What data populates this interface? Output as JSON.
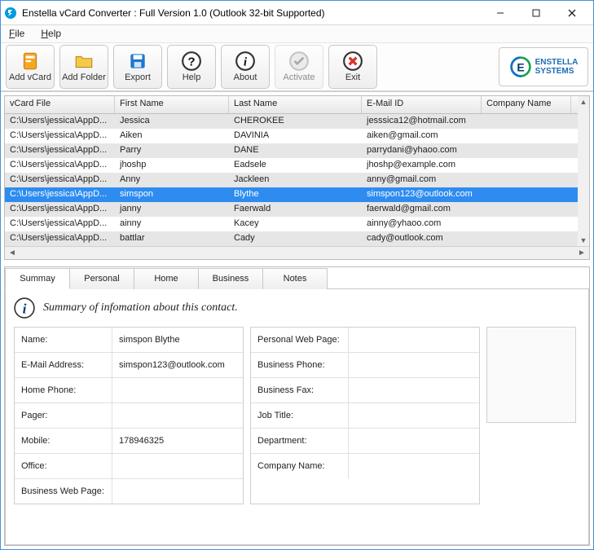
{
  "window": {
    "title": "Enstella vCard Converter : Full Version 1.0 (Outlook 32-bit Supported)"
  },
  "menu": {
    "file": "File",
    "help": "Help"
  },
  "toolbar": {
    "add_vcard": "Add vCard",
    "add_folder": "Add Folder",
    "export": "Export",
    "help": "Help",
    "about": "About",
    "activate": "Activate",
    "exit": "Exit"
  },
  "brand": {
    "line1": "ENSTELLA",
    "line2": "SYSTEMS"
  },
  "grid": {
    "headers": {
      "file": "vCard File",
      "first": "First Name",
      "last": "Last Name",
      "email": "E-Mail ID",
      "company": "Company Name"
    },
    "selected_index": 5,
    "rows": [
      {
        "file": "C:\\Users\\jessica\\AppD...",
        "first": "Jessica",
        "last": "CHEROKEE",
        "email": "jesssica12@hotmail.com",
        "company": ""
      },
      {
        "file": "C:\\Users\\jessica\\AppD...",
        "first": "Aiken",
        "last": "DAVINIA",
        "email": "aiken@gmail.com",
        "company": ""
      },
      {
        "file": "C:\\Users\\jessica\\AppD...",
        "first": "Parry",
        "last": "DANE",
        "email": "parrydani@yhaoo.com",
        "company": ""
      },
      {
        "file": "C:\\Users\\jessica\\AppD...",
        "first": "jhoshp",
        "last": "Eadsele",
        "email": "jhoshp@example.com",
        "company": ""
      },
      {
        "file": "C:\\Users\\jessica\\AppD...",
        "first": "Anny",
        "last": "Jackleen",
        "email": "anny@gmail.com",
        "company": ""
      },
      {
        "file": "C:\\Users\\jessica\\AppD...",
        "first": "simspon",
        "last": "Blythe",
        "email": "simspon123@outlook.com",
        "company": ""
      },
      {
        "file": "C:\\Users\\jessica\\AppD...",
        "first": "janny",
        "last": "Faerwald",
        "email": "faerwald@gmail.com",
        "company": ""
      },
      {
        "file": "C:\\Users\\jessica\\AppD...",
        "first": "ainny",
        "last": "Kacey",
        "email": "ainny@yhaoo.com",
        "company": ""
      },
      {
        "file": "C:\\Users\\jessica\\AppD...",
        "first": "battlar",
        "last": "Cady",
        "email": "cady@outlook.com",
        "company": ""
      }
    ]
  },
  "tabs": {
    "summary": "Summay",
    "personal": "Personal",
    "home": "Home",
    "business": "Business",
    "notes": "Notes"
  },
  "summary": {
    "heading": "Summary of infomation about this contact.",
    "fields_left": {
      "name_label": "Name:",
      "name_val": "simspon Blythe",
      "email_label": "E-Mail Address:",
      "email_val": "simspon123@outlook.com",
      "homephone_label": "Home Phone:",
      "homephone_val": "",
      "pager_label": "Pager:",
      "pager_val": "",
      "mobile_label": "Mobile:",
      "mobile_val": "178946325",
      "office_label": "Office:",
      "office_val": "",
      "bweb_label": "Business Web Page:",
      "bweb_val": ""
    },
    "fields_right": {
      "pweb_label": "Personal Web Page:",
      "pweb_val": "",
      "bphone_label": "Business Phone:",
      "bphone_val": "",
      "bfax_label": "Business Fax:",
      "bfax_val": "",
      "jtitle_label": "Job Title:",
      "jtitle_val": "",
      "dept_label": "Department:",
      "dept_val": "",
      "cname_label": "Company Name:",
      "cname_val": ""
    }
  }
}
